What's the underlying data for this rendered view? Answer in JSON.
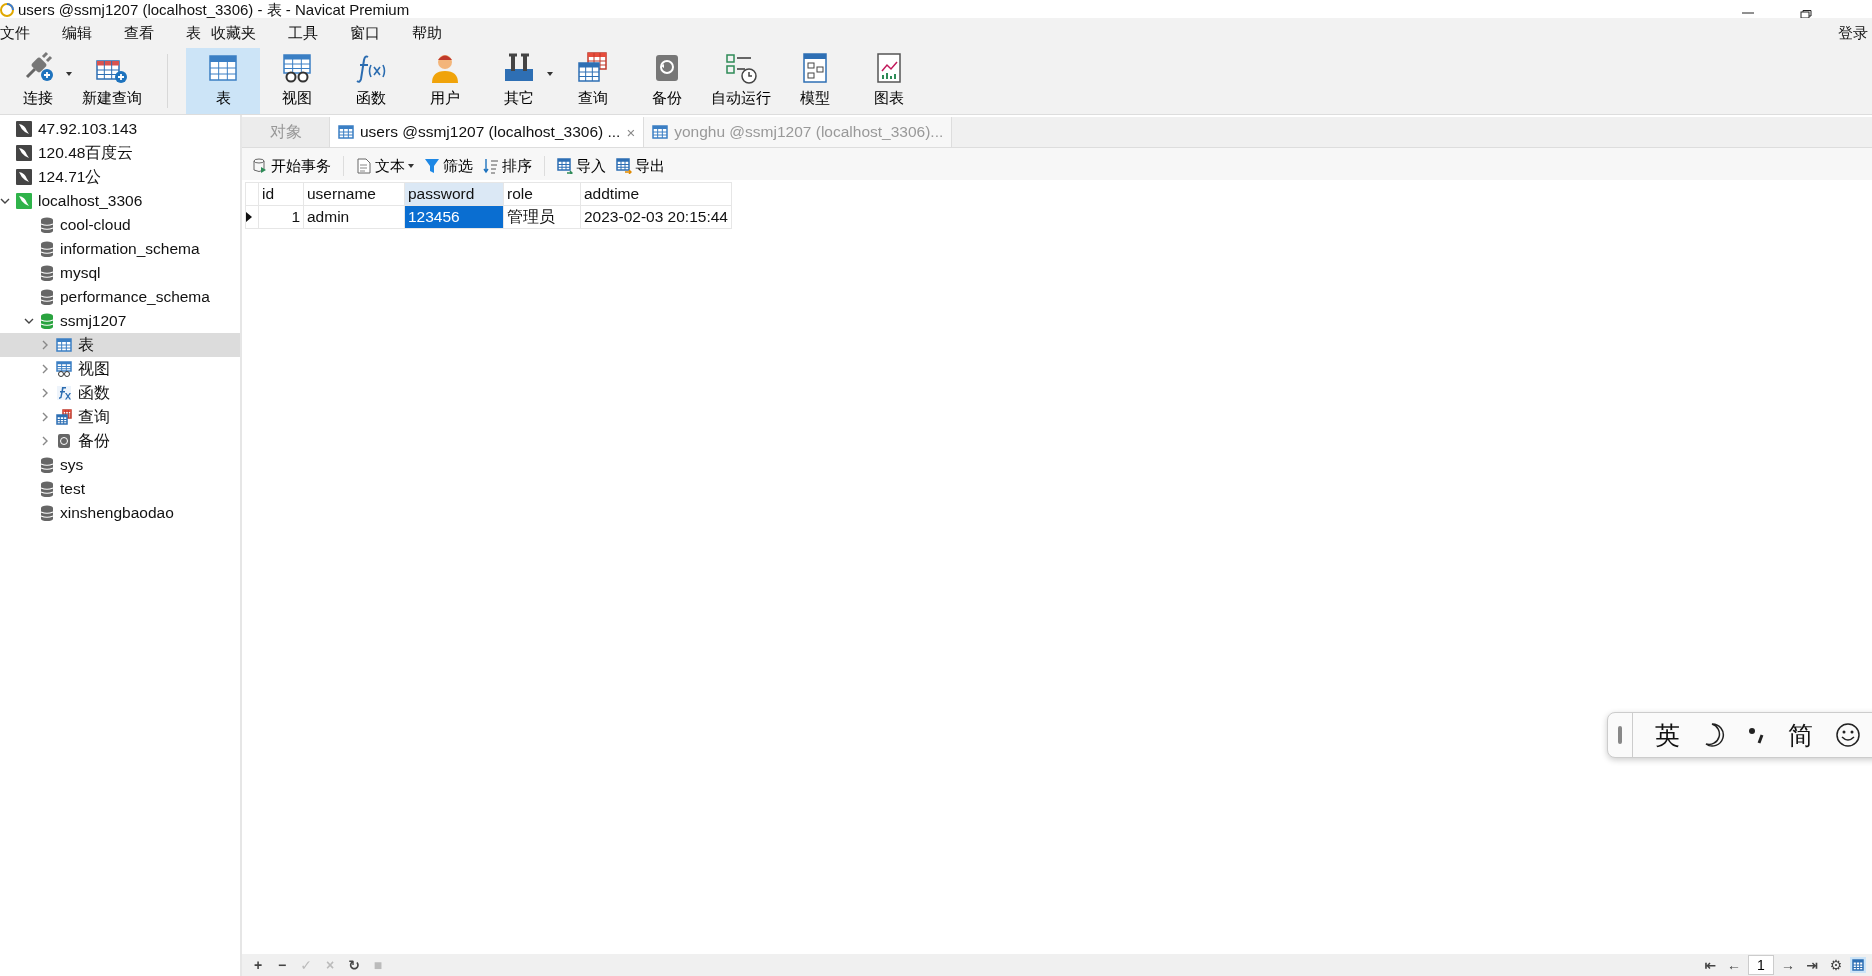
{
  "window": {
    "title": "users @ssmj1207 (localhost_3306) - 表 - Navicat Premium"
  },
  "menu": {
    "items": [
      "文件",
      "编辑",
      "查看",
      "表",
      "收藏夹",
      "工具",
      "窗口",
      "帮助"
    ],
    "login": "登录"
  },
  "toolbar": [
    {
      "label": "连接",
      "kind": "connect",
      "selected": false,
      "dropdown": true
    },
    {
      "label": "新建查询",
      "kind": "newquery",
      "selected": false,
      "dropdown": false
    },
    {
      "label": "表",
      "kind": "table",
      "selected": true,
      "dropdown": false
    },
    {
      "label": "视图",
      "kind": "view",
      "selected": false,
      "dropdown": false
    },
    {
      "label": "函数",
      "kind": "function",
      "selected": false,
      "dropdown": false
    },
    {
      "label": "用户",
      "kind": "user",
      "selected": false,
      "dropdown": false
    },
    {
      "label": "其它",
      "kind": "other",
      "selected": false,
      "dropdown": true
    },
    {
      "label": "查询",
      "kind": "query",
      "selected": false,
      "dropdown": false
    },
    {
      "label": "备份",
      "kind": "backup",
      "selected": false,
      "dropdown": false
    },
    {
      "label": "自动运行",
      "kind": "schedule",
      "selected": false,
      "dropdown": false
    },
    {
      "label": "模型",
      "kind": "model",
      "selected": false,
      "dropdown": false
    },
    {
      "label": "图表",
      "kind": "chart",
      "selected": false,
      "dropdown": false
    }
  ],
  "sidebar": {
    "items": [
      {
        "label": "47.92.103.143",
        "kind": "server",
        "active": false,
        "selected": false
      },
      {
        "label": "120.48百度云",
        "kind": "server",
        "active": false,
        "selected": false
      },
      {
        "label": "124.71公",
        "kind": "server",
        "active": false,
        "selected": false
      },
      {
        "label": "localhost_3306",
        "kind": "server",
        "active": true,
        "selected": false,
        "expanded": true,
        "children": [
          {
            "label": "cool-cloud",
            "kind": "database",
            "active": false,
            "selected": false
          },
          {
            "label": "information_schema",
            "kind": "database",
            "active": false,
            "selected": false
          },
          {
            "label": "mysql",
            "kind": "database",
            "active": false,
            "selected": false
          },
          {
            "label": "performance_schema",
            "kind": "database",
            "active": false,
            "selected": false
          },
          {
            "label": "ssmj1207",
            "kind": "database",
            "active": true,
            "selected": false,
            "expanded": true,
            "children": [
              {
                "label": "表",
                "kind": "table",
                "selected": true,
                "expanded": false
              },
              {
                "label": "视图",
                "kind": "view",
                "selected": false,
                "expanded": false
              },
              {
                "label": "函数",
                "kind": "function",
                "selected": false,
                "expanded": false
              },
              {
                "label": "查询",
                "kind": "query",
                "selected": false,
                "expanded": false
              },
              {
                "label": "备份",
                "kind": "backup",
                "selected": false,
                "expanded": false
              }
            ]
          },
          {
            "label": "sys",
            "kind": "database",
            "active": false,
            "selected": false
          },
          {
            "label": "test",
            "kind": "database",
            "active": false,
            "selected": false
          },
          {
            "label": "xinshengbaodao",
            "kind": "database",
            "active": false,
            "selected": false
          }
        ]
      }
    ]
  },
  "tabs": [
    {
      "label": "对象",
      "kind": "objects",
      "selected": false
    },
    {
      "label": "users @ssmj1207 (localhost_3306) ...",
      "kind": "table",
      "selected": true,
      "close": "×"
    },
    {
      "label": "yonghu @ssmj1207 (localhost_3306)...",
      "kind": "table",
      "selected": false
    }
  ],
  "actions": [
    {
      "label": "开始事务",
      "kind": "transaction",
      "dropdown": false
    },
    {
      "label": "文本",
      "kind": "text",
      "dropdown": true
    },
    {
      "label": "筛选",
      "kind": "filter",
      "dropdown": false
    },
    {
      "label": "排序",
      "kind": "sort",
      "dropdown": false
    },
    {
      "label": "导入",
      "kind": "import",
      "dropdown": false
    },
    {
      "label": "导出",
      "kind": "export",
      "dropdown": false
    }
  ],
  "table": {
    "columns": [
      {
        "label": "id",
        "selected": false
      },
      {
        "label": "username",
        "selected": false
      },
      {
        "label": "password",
        "selected": true
      },
      {
        "label": "role",
        "selected": false
      },
      {
        "label": "addtime",
        "selected": false
      }
    ],
    "rows": [
      {
        "current": true,
        "cells": [
          {
            "text": "1",
            "selected": false
          },
          {
            "text": "admin",
            "selected": false
          },
          {
            "text": "123456",
            "selected": true
          },
          {
            "text": "管理员",
            "selected": false
          },
          {
            "text": "2023-02-03 20:15:44",
            "selected": false
          }
        ]
      }
    ]
  },
  "status_bar": {
    "edit_buttons": [
      {
        "symbol": "+",
        "disabled": false
      },
      {
        "symbol": "−",
        "disabled": false
      },
      {
        "symbol": "✓",
        "disabled": true
      },
      {
        "symbol": "×",
        "disabled": true
      },
      {
        "symbol": "↻",
        "disabled": false
      },
      {
        "symbol": "■",
        "disabled": true
      }
    ],
    "nav_buttons": [
      {
        "symbol": "⇤"
      },
      {
        "symbol": "←"
      }
    ],
    "page": "1",
    "nav_buttons_after": [
      {
        "symbol": "→"
      },
      {
        "symbol": "⇥"
      },
      {
        "symbol": "⚙"
      }
    ]
  },
  "ime_bar": {
    "language": "英",
    "script": "简"
  }
}
